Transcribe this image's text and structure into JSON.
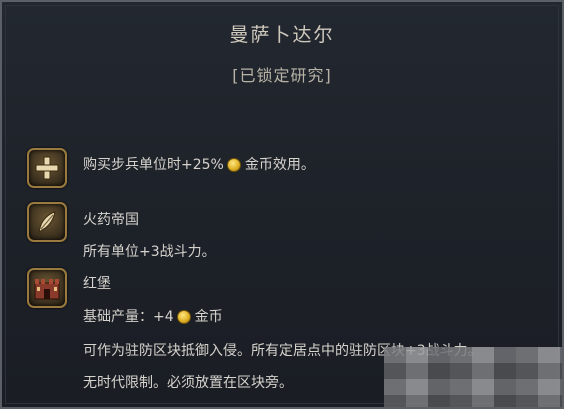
{
  "header": {
    "title": "曼萨卜达尔",
    "status": "[已锁定研究]"
  },
  "effects": [
    {
      "icon": "plus-icon",
      "line1_prefix": "购买步兵单位时+25%",
      "line1_coin_icon": "gold-coin-icon",
      "line1_suffix": "金币效用。"
    },
    {
      "icon": "quill-icon",
      "name": "火药帝国",
      "description": "所有单位+3战斗力。"
    },
    {
      "icon": "red-fort-icon",
      "name": "红堡",
      "yield_prefix": "基础产量：+4",
      "yield_coin_icon": "gold-coin-icon",
      "yield_suffix": "金币",
      "description1": "可作为驻防区块抵御入侵。所有定居点中的驻防区块+3战斗力。",
      "description2": "无时代限制。必须放置在区块旁。"
    }
  ],
  "colors": {
    "panel_background": "#1d2128",
    "panel_border": "#5b5f66",
    "icon_frame": "#9a7a3e",
    "text_primary": "#d6d3cd",
    "text_title": "#cfc9bc",
    "coin_gold": "#e0b228"
  }
}
